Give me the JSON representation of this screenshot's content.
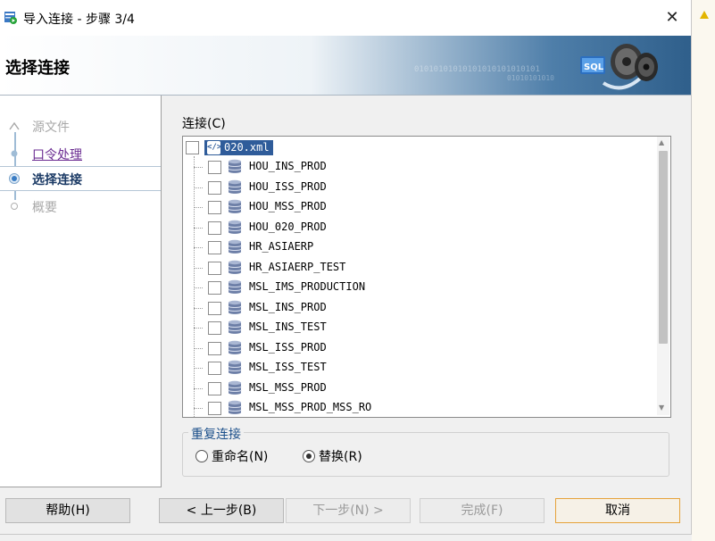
{
  "window": {
    "title": "导入连接 - 步骤 3/4",
    "close_glyph": "✕"
  },
  "banner": {
    "title": "选择连接",
    "binary_line1": "01010101010101010101010101",
    "binary_line2": "01010101010"
  },
  "steps": [
    {
      "label": "源文件",
      "state": "done"
    },
    {
      "label": "口令处理",
      "state": "link"
    },
    {
      "label": "选择连接",
      "state": "current"
    },
    {
      "label": "概要",
      "state": "todo"
    }
  ],
  "connections": {
    "label": "连接(C)",
    "root": {
      "name": "020.xml",
      "icon": "xml-file-icon"
    },
    "items": [
      "HOU_INS_PROD",
      "HOU_ISS_PROD",
      "HOU_MSS_PROD",
      "HOU_020_PROD",
      "HR_ASIAERP",
      "HR_ASIAERP_TEST",
      "MSL_IMS_PRODUCTION",
      "MSL_INS_PROD",
      "MSL_INS_TEST",
      "MSL_ISS_PROD",
      "MSL_ISS_TEST",
      "MSL_MSS_PROD",
      "MSL_MSS_PROD_MSS_RO"
    ]
  },
  "duplicates": {
    "title": "重复连接",
    "options": [
      {
        "label": "重命名(N)",
        "selected": false
      },
      {
        "label": "替换(R)",
        "selected": true
      }
    ]
  },
  "buttons": {
    "help": "帮助(H)",
    "back": "< 上一步(B)",
    "next": "下一步(N) >",
    "finish": "完成(F)",
    "cancel": "取消"
  },
  "colors": {
    "selection": "#2f5c9a",
    "accent_link": "#6a2b91",
    "group_title": "#1b4f8a",
    "default_button_border": "#e6a23a"
  }
}
